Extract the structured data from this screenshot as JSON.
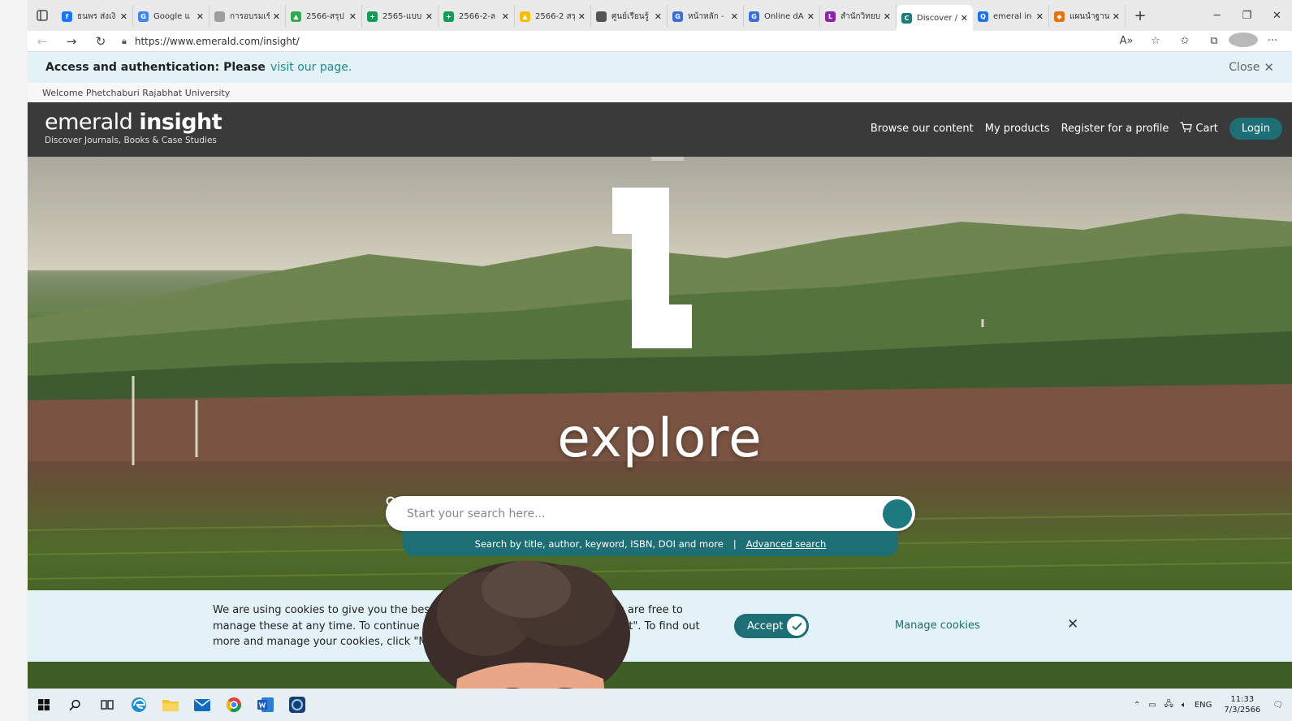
{
  "browser": {
    "tabs": [
      {
        "label": "ธนพร ส่งเงิ",
        "color": "#1877f2",
        "glyph": "f"
      },
      {
        "label": "Google แ",
        "color": "#4285f4",
        "glyph": "G"
      },
      {
        "label": "การอบรมเชิ",
        "color": "#9e9e9e",
        "glyph": ""
      },
      {
        "label": "2566-สรุป",
        "color": "#34a853",
        "glyph": "▲"
      },
      {
        "label": "2565-แบบ",
        "color": "#0f9d58",
        "glyph": "+"
      },
      {
        "label": "2566-2-ล",
        "color": "#0f9d58",
        "glyph": "+"
      },
      {
        "label": "2566-2 สรุ",
        "color": "#fbbc04",
        "glyph": "▲"
      },
      {
        "label": "ศูนย์เรียนรู้",
        "color": "#555555",
        "glyph": ""
      },
      {
        "label": "หน้าหลัก -",
        "color": "#3b6fd6",
        "glyph": "G"
      },
      {
        "label": "Online dA",
        "color": "#3b6fd6",
        "glyph": "G"
      },
      {
        "label": "สำนักวิทยบ",
        "color": "#8e24aa",
        "glyph": "L"
      },
      {
        "label": "Discover /",
        "color": "#1d7880",
        "glyph": "C",
        "active": true
      },
      {
        "label": "emeral in",
        "color": "#1a73e8",
        "glyph": "Q"
      },
      {
        "label": "แผนนำฐานะ",
        "color": "#e8710a",
        "glyph": "◆"
      }
    ],
    "url": "https://www.emerald.com/insight/"
  },
  "access_banner": {
    "text": "Access and authentication: Please",
    "link": "visit our page.",
    "close_label": "Close"
  },
  "welcome_text": "Welcome Phetchaburi Rajabhat University",
  "header": {
    "logo_light": "emerald",
    "logo_bold": "insight",
    "tagline": "Discover Journals, Books & Case Studies",
    "nav": {
      "browse": "Browse our content",
      "products": "My products",
      "register": "Register for a profile",
      "cart": "Cart",
      "login": "Login"
    }
  },
  "hero": {
    "headline": "explore",
    "search_placeholder": "Start your search here...",
    "search_hint": "Search by title, author, keyword, ISBN, DOI and more",
    "separator": "|",
    "advanced_link": "Advanced search"
  },
  "cookie": {
    "text": "We are using cookies to give you the best experience on our website, but you are free to manage these at any time. To continue with our standard settings click \"Accept\". To find out more and manage your cookies, click \"Manage cookies\".",
    "accept_label": "Accept",
    "manage_label": "Manage cookies"
  },
  "taskbar": {
    "lang": "ENG",
    "time": "11:33",
    "date": "7/3/2566"
  },
  "colors": {
    "brand_teal": "#1d6f75",
    "header_dark": "#3a3a3a",
    "banner_bg": "#e2f2f7"
  }
}
